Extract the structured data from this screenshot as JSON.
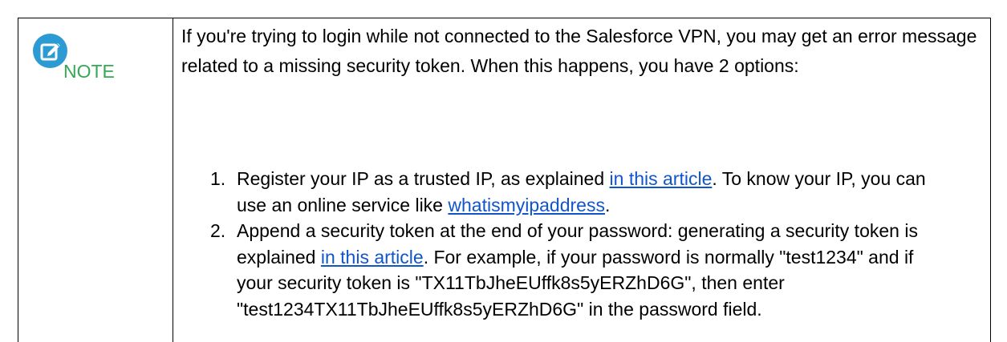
{
  "note": {
    "label": "NOTE",
    "icon": "edit-note-icon",
    "icon_color": "#2d9bd3",
    "label_color": "#34a853",
    "intro": "If you're trying to login while not connected to the Salesforce VPN, you may get an error message related to a missing security token. When this happens, you have 2 options:",
    "options": [
      {
        "number": "1.",
        "text_1": "Register your IP as a trusted IP, as explained ",
        "link_1": "in this article",
        "text_2": ".  To know your IP, you can use an online service like ",
        "link_2": "whatismyipaddress",
        "text_3": "."
      },
      {
        "number": "2.",
        "text_1": "Append a security token at the end of your password: generating a security token is explained ",
        "link_1": "in this article",
        "text_2": ". For example, if your password is normally \"test1234\" and if your security token is \"TX11TbJheEUffk8s5yERZhD6G\", then enter \"test1234TX11TbJheEUffk8s5yERZhD6G\" in the password field."
      }
    ],
    "link_color": "#1155cc"
  }
}
